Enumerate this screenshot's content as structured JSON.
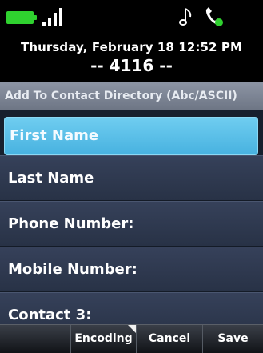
{
  "status": {
    "battery_color": "#2fd12f",
    "icons": [
      "battery-icon",
      "signal-icon",
      "music-note-icon",
      "handset-icon"
    ]
  },
  "header": {
    "date_time": "Thursday, February 18 12:52 PM",
    "extension": "-- 4116 --"
  },
  "title": "Add To Contact Directory (Abc/ASCII)",
  "fields": [
    {
      "label": "First Name",
      "selected": true
    },
    {
      "label": "Last Name"
    },
    {
      "label": "Phone Number:"
    },
    {
      "label": "Mobile Number:"
    },
    {
      "label": "Contact 3:"
    }
  ],
  "softkeys": {
    "encoding": "Encoding",
    "cancel": "Cancel",
    "save": "Save"
  },
  "colors": {
    "selected_row": "#5cc0ea",
    "row": "#2e3850",
    "title_bar": "#7d8595"
  }
}
